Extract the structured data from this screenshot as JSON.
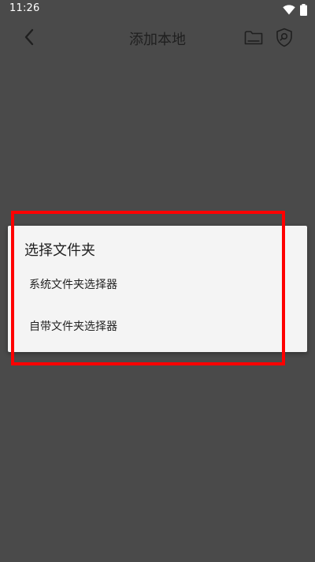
{
  "status_bar": {
    "time": "11:26",
    "icons": [
      "wifi-icon",
      "battery-icon"
    ]
  },
  "app_bar": {
    "title": "添加本地",
    "back_icon": "back-arrow-icon",
    "actions": [
      "folder-icon",
      "shield-search-icon"
    ]
  },
  "dialog": {
    "title": "选择文件夹",
    "options": [
      {
        "label": "系统文件夹选择器"
      },
      {
        "label": "自带文件夹选择器"
      }
    ]
  },
  "colors": {
    "background": "#4a4a4a",
    "dialog_background": "#f4f4f4",
    "highlight": "#ff0000",
    "text_dark": "#1f1f1f"
  }
}
